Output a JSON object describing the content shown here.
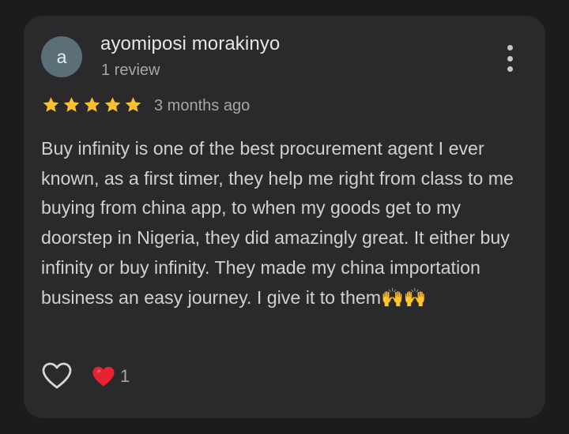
{
  "review": {
    "avatar_letter": "a",
    "reviewer_name": "ayomiposi morakinyo",
    "review_count": "1 review",
    "rating": 5,
    "rating_max": 5,
    "time_ago": "3 months ago",
    "text": "Buy infinity is one of the best procurement agent I ever known, as a first timer, they help me right from class to me buying from china app, to when my goods get to my doorstep in Nigeria, they did amazingly great. It either buy infinity or buy infinity. They made my china importation business an easy journey. I give it to them🙌🙌",
    "reaction_count": "1"
  },
  "colors": {
    "star": "#fbc02d",
    "heart": "#e8222f",
    "avatar_bg": "#5b6f79",
    "card_bg": "#2a2a2c"
  },
  "icons": {
    "more": "more-vert-icon",
    "like": "heart-outline-icon",
    "reaction": "heart-filled-icon"
  }
}
